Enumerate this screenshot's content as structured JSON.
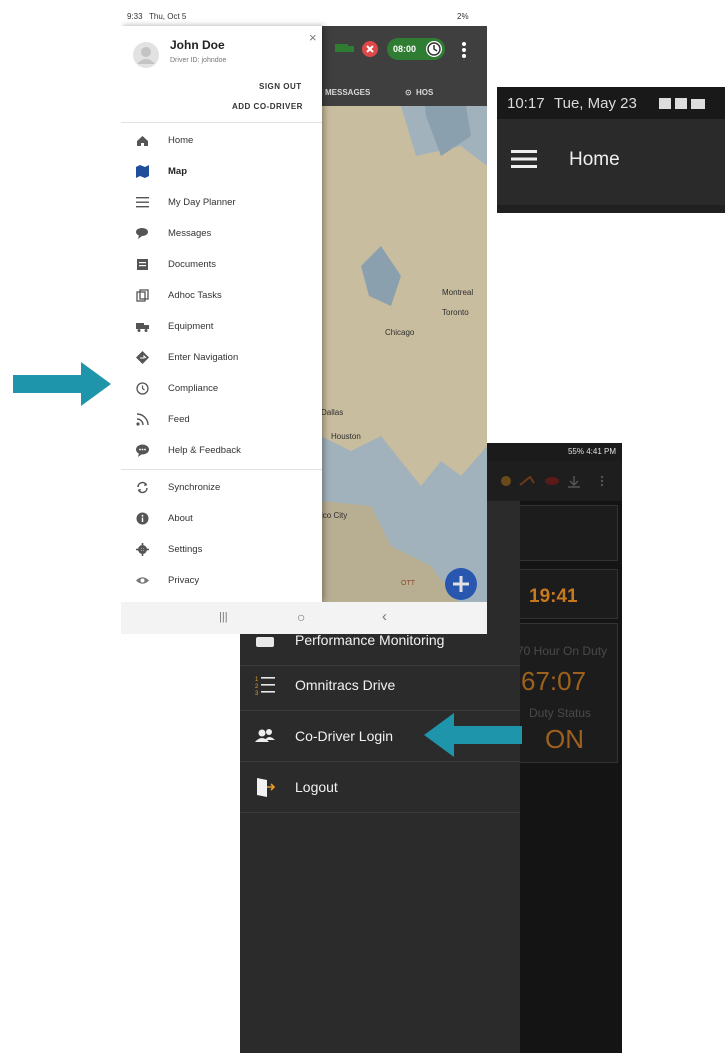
{
  "colors": {
    "accent_teal": "#1e95ab",
    "amber": "#c8781e",
    "map_water": "#b9cbd6",
    "active_blue": "#1f4e9a"
  },
  "top_phone": {
    "status_time": "9:33",
    "status_date": "Thu, Oct 5",
    "status_right": "2%",
    "user_name": "John Doe",
    "driver_id": "Driver ID: johndoe",
    "sign_out": "SIGN OUT",
    "add_codriver": "ADD CO-DRIVER",
    "timer": "08:00",
    "tab_messages": "MESSAGES",
    "tab_hos": "HOS",
    "map_labels": [
      "Montreal",
      "Toronto",
      "Chicago",
      "Dallas",
      "Houston",
      "ico City",
      "OTT"
    ],
    "menu": [
      {
        "label": "Home",
        "icon": "home-icon"
      },
      {
        "label": "Map",
        "icon": "map-icon",
        "active": true
      },
      {
        "label": "My Day Planner",
        "icon": "list-icon"
      },
      {
        "label": "Messages",
        "icon": "chat-icon"
      },
      {
        "label": "Documents",
        "icon": "document-icon"
      },
      {
        "label": "Adhoc Tasks",
        "icon": "tasks-icon"
      },
      {
        "label": "Equipment",
        "icon": "truck-icon"
      },
      {
        "label": "Enter Navigation",
        "icon": "navigation-icon"
      },
      {
        "label": "Compliance",
        "icon": "clock-icon"
      },
      {
        "label": "Feed",
        "icon": "rss-icon"
      },
      {
        "label": "Help & Feedback",
        "icon": "feedback-icon"
      }
    ],
    "menu2": [
      {
        "label": "Synchronize",
        "icon": "sync-icon"
      },
      {
        "label": "About",
        "icon": "info-icon"
      },
      {
        "label": "Settings",
        "icon": "settings-icon"
      },
      {
        "label": "Privacy",
        "icon": "eye-icon"
      }
    ]
  },
  "snippet": {
    "time": "10:17",
    "date": "Tue, May 23",
    "title": "Home"
  },
  "bottom_phone": {
    "status": "55% 4:41 PM",
    "items": [
      {
        "label": "Performance Monitoring",
        "icon": "gauge-icon"
      },
      {
        "label": "Omnitracs Drive",
        "icon": "numbered-list-icon"
      },
      {
        "label": "Co-Driver Login",
        "icon": "users-icon"
      },
      {
        "label": "Logout",
        "icon": "logout-icon"
      }
    ],
    "right_time": "19:41",
    "right_time_prefix": "9",
    "hours_label": "70 Hour On Duty",
    "hours_value": "67:07",
    "duty_label": "Duty Status",
    "duty_value": "ON"
  }
}
